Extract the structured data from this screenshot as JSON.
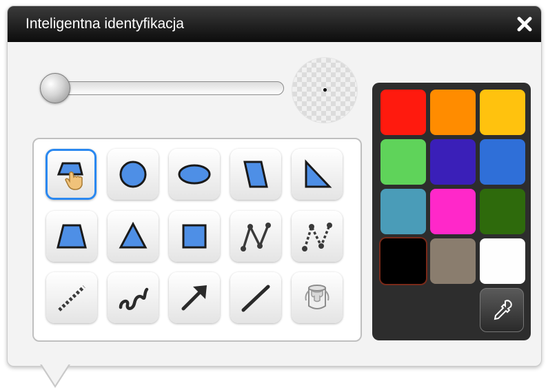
{
  "window": {
    "title": "Inteligentna identyfikacja"
  },
  "line_width": {
    "level_fraction": 0.0
  },
  "tools": [
    {
      "id": "smart-shape",
      "icon": "smart-shape-hand-icon",
      "selected": true
    },
    {
      "id": "circle",
      "icon": "circle-icon"
    },
    {
      "id": "ellipse",
      "icon": "ellipse-icon"
    },
    {
      "id": "parallelogram",
      "icon": "parallelogram-icon"
    },
    {
      "id": "right-triangle",
      "icon": "right-triangle-icon"
    },
    {
      "id": "trapezoid",
      "icon": "trapezoid-icon"
    },
    {
      "id": "triangle",
      "icon": "triangle-icon"
    },
    {
      "id": "square",
      "icon": "square-icon"
    },
    {
      "id": "polyline",
      "icon": "polyline-icon"
    },
    {
      "id": "dashed-polyline",
      "icon": "dashed-polyline-icon"
    },
    {
      "id": "dashed-line",
      "icon": "dashed-line-icon"
    },
    {
      "id": "freehand",
      "icon": "freehand-icon"
    },
    {
      "id": "arrow",
      "icon": "arrow-icon"
    },
    {
      "id": "line",
      "icon": "line-icon"
    },
    {
      "id": "fill",
      "icon": "paint-bucket-icon"
    }
  ],
  "colors": [
    {
      "name": "red",
      "hex": "#ff1a0e"
    },
    {
      "name": "orange",
      "hex": "#ff8c00"
    },
    {
      "name": "yellow",
      "hex": "#ffc20e"
    },
    {
      "name": "green",
      "hex": "#5fd35a"
    },
    {
      "name": "indigo",
      "hex": "#3a1fb8"
    },
    {
      "name": "blue",
      "hex": "#2f6fd8"
    },
    {
      "name": "teal",
      "hex": "#4a9cb8"
    },
    {
      "name": "magenta",
      "hex": "#ff28c9"
    },
    {
      "name": "dark-green",
      "hex": "#2e6a0c"
    },
    {
      "name": "black",
      "hex": "#000000",
      "selected": true
    },
    {
      "name": "taupe",
      "hex": "#8a7d6e"
    },
    {
      "name": "white",
      "hex": "#fefefe"
    }
  ],
  "accent": "#2a88f0",
  "shape_fill": "#4e8fe6"
}
